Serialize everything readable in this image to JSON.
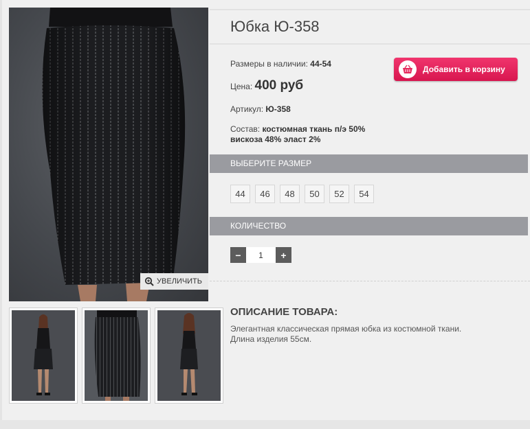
{
  "product": {
    "title": "Юбка Ю-358",
    "sizes_label": "Размеры в наличии:",
    "sizes_value": "44-54",
    "price_label": "Цена:",
    "price_value": "400 руб",
    "article_label": "Артикул:",
    "article_value": "Ю-358",
    "composition_label": "Состав:",
    "composition_line1": "костюмная ткань п/э 50%",
    "composition_line2": "вискоза 48% эласт 2%"
  },
  "cart_button": {
    "label": "Добавить в корзину",
    "icon": "basket-icon",
    "color": "#e52a5e"
  },
  "zoom_button": {
    "label": "УВЕЛИЧИТЬ",
    "icon": "magnifier-icon"
  },
  "size_section": {
    "title": "ВЫБЕРИТЕ РАЗМЕР",
    "options": [
      "44",
      "46",
      "48",
      "50",
      "52",
      "54"
    ]
  },
  "quantity_section": {
    "title": "КОЛИЧЕСТВО",
    "minus": "−",
    "plus": "+",
    "value": "1"
  },
  "description": {
    "title": "ОПИСАНИЕ ТОВАРА:",
    "line1": "Элегантная классическая прямая юбка из костюмной ткани.",
    "line2": "Длина изделия 55см."
  },
  "colors": {
    "section_bar": "#9a9ba0",
    "accent": "#e52a5e",
    "qty_button": "#5c5c5c"
  }
}
